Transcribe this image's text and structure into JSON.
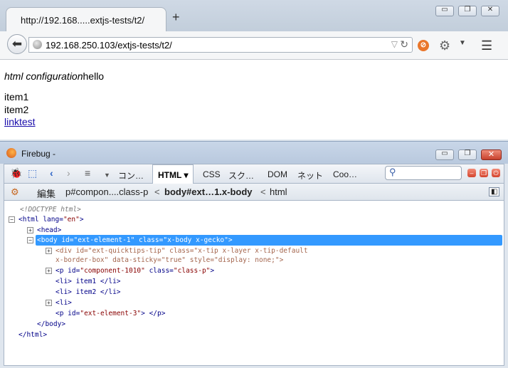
{
  "browser": {
    "tab_title": "http://192.168.....extjs-tests/t2/",
    "new_tab": "+",
    "window_controls": {
      "minimize": "▭",
      "restore": "❐",
      "close": "✕"
    },
    "url": "192.168.250.103/extjs-tests/t2/",
    "back_icon": "back-arrow-icon",
    "addons": [
      "noscript-icon",
      "gear-icon",
      "dropdown-icon",
      "hamburger-menu-icon"
    ]
  },
  "page": {
    "config_italic": "html configuration",
    "config_text": "hello",
    "items": [
      "item1",
      "item2"
    ],
    "link": "linktest"
  },
  "firebug": {
    "title": "Firebug -",
    "tabs": [
      {
        "label": "コン…"
      },
      {
        "label": "HTML ▾",
        "active": true
      },
      {
        "label": "CSS"
      },
      {
        "label": "スク…"
      },
      {
        "label": "DOM"
      },
      {
        "label": "ネット"
      },
      {
        "label": "Coo…"
      }
    ],
    "search_placeholder": "",
    "breadcrumbs": {
      "edit": "編集",
      "c1": "p#compon....class-p",
      "sep1": "<",
      "c2": "body#ext…1.x-body",
      "sep2": "<",
      "c3": "html"
    },
    "tree": {
      "doctype": "<!DOCTYPE html>",
      "html_open_tag": "<html",
      "html_attr": " lang=",
      "html_val": "\"en\"",
      "html_close": ">",
      "head": "<head>",
      "body_tag": "<body",
      "body_attr1": " id=",
      "body_val1": "\"ext-element-1\"",
      "body_attr2": " class=",
      "body_val2": "\"x-body x-gecko\"",
      "body_end": ">",
      "div_line1": "<div id=\"ext-quicktips-tip\" class=\"x-tip x-layer x-tip-default",
      "div_line2": "x-border-box\" data-sticky=\"true\" style=\"display: none;\">",
      "p_tag": "<p",
      "p_attr1": " id=",
      "p_val1": "\"component-1010\"",
      "p_attr2": " class=",
      "p_val2": "\"class-p\"",
      "p_end": ">",
      "li1": "<li> item1 </li>",
      "li2": "<li> item2 </li>",
      "li3": "<li>",
      "p2_tag": "<p",
      "p2_attr": " id=",
      "p2_val": "\"ext-element-3\"",
      "p2_end": "> </p>",
      "body_close": "</body>",
      "html_close_tag": "</html>"
    }
  }
}
